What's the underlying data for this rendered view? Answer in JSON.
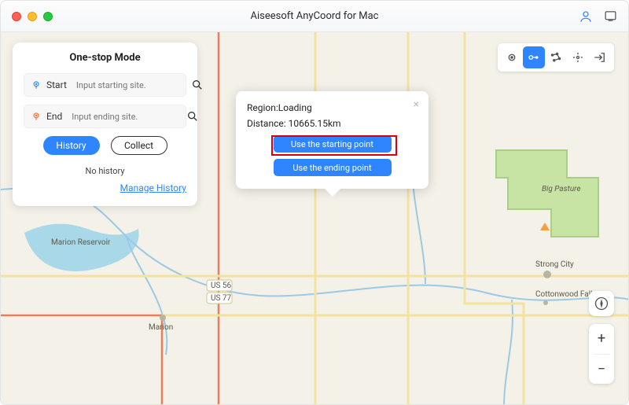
{
  "titlebar": {
    "title": "Aiseesoft AnyCoord for Mac"
  },
  "panel": {
    "heading": "One-stop Mode",
    "start": {
      "label": "Start",
      "placeholder": "Input starting site."
    },
    "end": {
      "label": "End",
      "placeholder": "Input ending site."
    },
    "history_btn": "History",
    "collect_btn": "Collect",
    "no_history": "No history",
    "manage_history": "Manage History"
  },
  "popover": {
    "region_label": "Region:",
    "region_value": "Loading",
    "distance_label": "Distance: ",
    "distance_value": "10665.15km",
    "use_start": "Use the starting point",
    "use_end": "Use the ending point"
  },
  "zoom": {
    "plus": "+",
    "minus": "−"
  },
  "map": {
    "labels": {
      "marion_res": "Marion Reservoir",
      "marion": "Marion",
      "strong_city": "Strong City",
      "cottonwood": "Cottonwood Falls",
      "big_pasture": "Big Pasture",
      "us56": "US 56",
      "us77": "US 77"
    }
  }
}
